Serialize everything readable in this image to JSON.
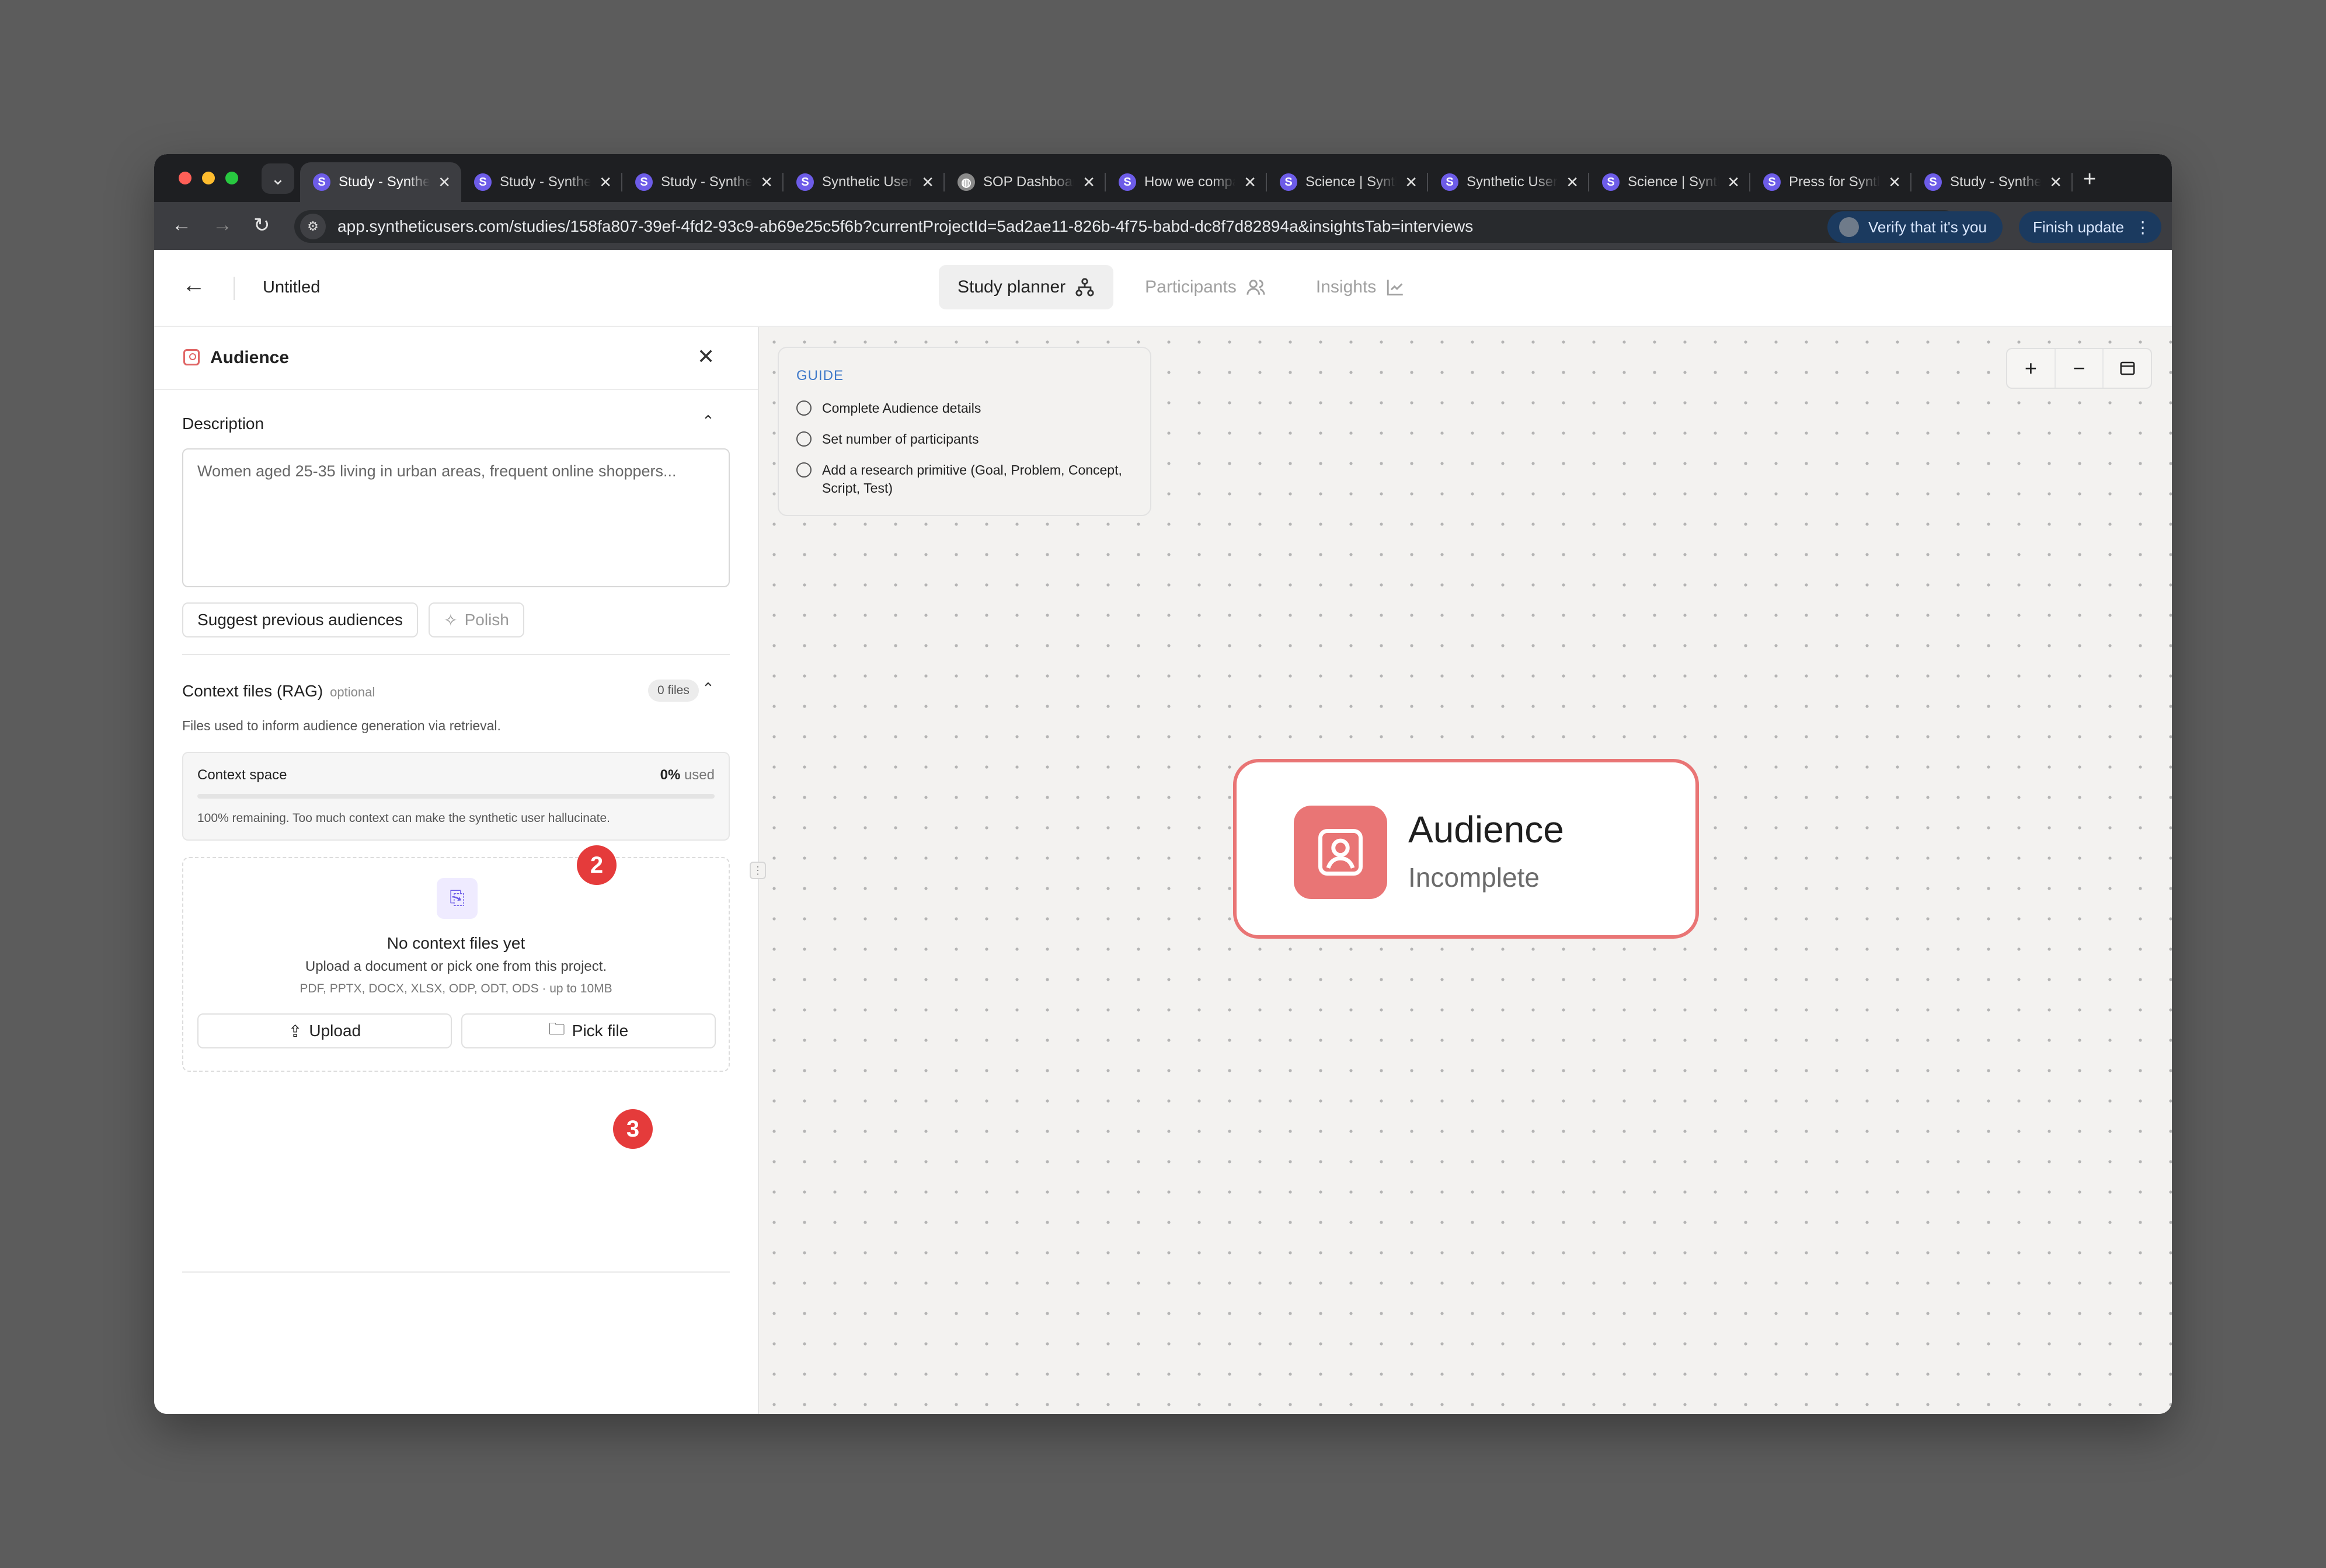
{
  "browser": {
    "tabs": [
      {
        "title": "Study - Synthetic Users",
        "favicon": "S",
        "active": true
      },
      {
        "title": "Study - Synthetic Users",
        "favicon": "S"
      },
      {
        "title": "Study - Synthetic Users",
        "favicon": "S"
      },
      {
        "title": "Synthetic Users",
        "favicon": "S"
      },
      {
        "title": "SOP Dashboard",
        "favicon": "globe"
      },
      {
        "title": "How we compare",
        "favicon": "S"
      },
      {
        "title": "Science | Synthetic Users",
        "favicon": "S"
      },
      {
        "title": "Synthetic Users",
        "favicon": "S"
      },
      {
        "title": "Science | Synthetic Users",
        "favicon": "S"
      },
      {
        "title": "Press for Synthetic Users",
        "favicon": "S"
      },
      {
        "title": "Study - Synthetic Users",
        "favicon": "S"
      }
    ],
    "url": "app.syntheticusers.com/studies/158fa807-39ef-4fd2-93c9-ab69e25c5f6b?currentProjectId=5ad2ae11-826b-4f75-babd-dc8f7d82894a&insightsTab=interviews",
    "verify_label": "Verify that it's you",
    "finish_label": "Finish update"
  },
  "header": {
    "title": "Untitled",
    "tabs": [
      {
        "label": "Study planner",
        "icon": "sitemap-icon",
        "active": true
      },
      {
        "label": "Participants",
        "icon": "users-icon"
      },
      {
        "label": "Insights",
        "icon": "chart-icon"
      }
    ]
  },
  "sidebar": {
    "title": "Audience",
    "description": {
      "label": "Description",
      "placeholder": "Women aged 25-35 living in urban areas, frequent online shoppers..."
    },
    "suggest_label": "Suggest previous audiences",
    "polish_label": "Polish",
    "context": {
      "label": "Context files (RAG)",
      "optional": "optional",
      "files_count": "0 files",
      "hint": "Files used to inform audience generation via retrieval.",
      "space_label": "Context space",
      "used_pct": "0%",
      "used_word": "used",
      "used_fraction": 0,
      "note": "100% remaining. Too much context can make the synthetic user hallucinate.",
      "empty_title": "No context files yet",
      "empty_sub": "Upload a document or pick one from this project.",
      "formats": "PDF, PPTX, DOCX, XLSX, ODP, ODT, ODS · up to 10MB",
      "upload_label": "Upload",
      "pick_label": "Pick file"
    },
    "annotations": {
      "badge_2": "2",
      "badge_3": "3"
    }
  },
  "canvas": {
    "guide": {
      "title": "GUIDE",
      "items": [
        "Complete Audience details",
        "Set number of participants",
        "Add a research primitive (Goal, Problem, Concept, Script, Test)"
      ]
    },
    "zoom": {
      "in": "+",
      "out": "−"
    },
    "node": {
      "title": "Audience",
      "status": "Incomplete"
    }
  },
  "colors": {
    "accent_red": "#e97575",
    "badge_red": "#e53b3b",
    "brand_purple": "#6d5ce8",
    "guide_blue": "#3d78c9"
  }
}
